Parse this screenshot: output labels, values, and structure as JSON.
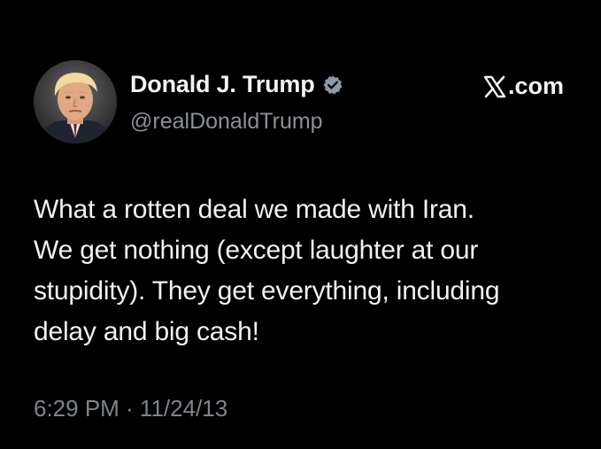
{
  "author": {
    "display_name": "Donald J. Trump",
    "handle": "@realDonaldTrump",
    "verified": true,
    "verified_color": "#8a9aa8",
    "avatar": "profile-photo"
  },
  "brand": {
    "icon": "x-logo-icon",
    "suffix": ".com"
  },
  "tweet": {
    "lines": [
      "What a rotten deal we made with Iran.",
      "We get nothing (except laughter at our",
      "stupidity). They get everything, including",
      "delay and big cash!"
    ],
    "timestamp": "6:29 PM · 11/24/13"
  },
  "colors": {
    "background": "#000000",
    "text": "#f1f1f1",
    "secondary_text": "#8b9096"
  }
}
